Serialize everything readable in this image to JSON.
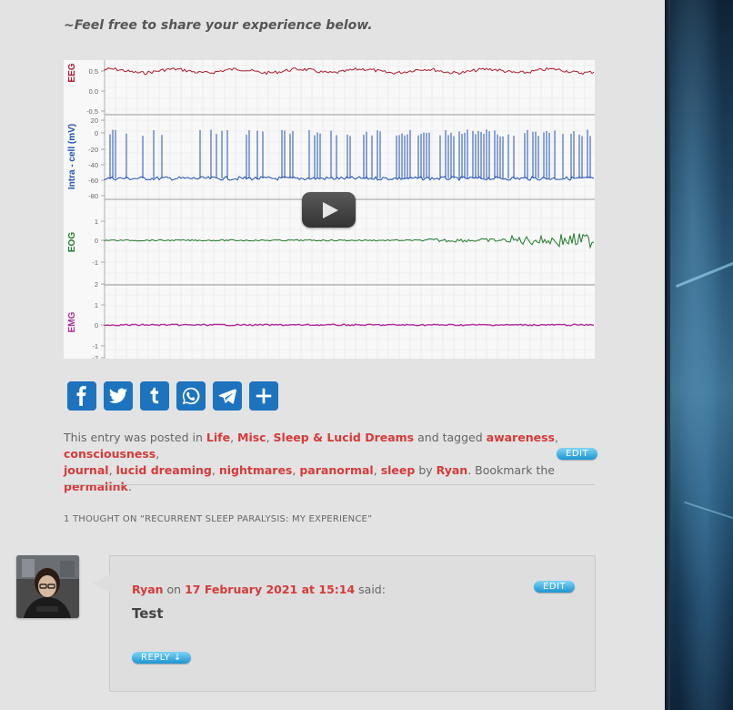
{
  "intro": "~Feel free to share your experience below.",
  "video": {
    "labels": {
      "eeg": "EEG",
      "intra": "Intra - cell (mV)",
      "eog": "EOG",
      "emg": "EMG"
    },
    "ticks": {
      "eeg": [
        "0.5",
        "0.0",
        "-0.5"
      ],
      "intra": [
        "20",
        "0",
        "-20",
        "-40",
        "-60",
        "-80"
      ],
      "eog": [
        "1",
        "0",
        "-1"
      ],
      "emg": [
        "2",
        "1",
        "0",
        "-1",
        "-2"
      ]
    },
    "colors": {
      "eeg": "#b01c2e",
      "intra": "#1f4fb5",
      "eog": "#1f7a2a",
      "emg": "#b02a9b"
    }
  },
  "share": {
    "items": [
      {
        "name": "facebook-icon",
        "label": "Facebook"
      },
      {
        "name": "twitter-icon",
        "label": "Twitter"
      },
      {
        "name": "tumblr-icon",
        "label": "Tumblr"
      },
      {
        "name": "whatsapp-icon",
        "label": "WhatsApp"
      },
      {
        "name": "telegram-icon",
        "label": "Telegram"
      },
      {
        "name": "share-plus-icon",
        "label": "Share"
      }
    ],
    "color": "#1e73be"
  },
  "meta": {
    "posted_in": "This entry was posted in",
    "categories": [
      "Life",
      "Misc",
      "Sleep & Lucid Dreams"
    ],
    "and_tagged": "and tagged",
    "tags": [
      "awareness",
      "consciousness",
      "journal",
      "lucid dreaming",
      "nightmares",
      "paranormal",
      "sleep"
    ],
    "by": "by",
    "author": "Ryan",
    "bookmark": "Bookmark the",
    "permalink": "permalink",
    "edit": "EDIT"
  },
  "thoughts_title": "1 THOUGHT ON “RECURRENT SLEEP PARALYSIS: MY EXPERIENCE”",
  "comment": {
    "author": "Ryan",
    "on": "on",
    "date": "17 February 2021 at 15:14",
    "said": "said:",
    "text": "Test",
    "edit": "EDIT",
    "reply": "REPLY ↓"
  },
  "colors": {
    "link": "#d63a3a",
    "pill": "#1b96d2"
  }
}
